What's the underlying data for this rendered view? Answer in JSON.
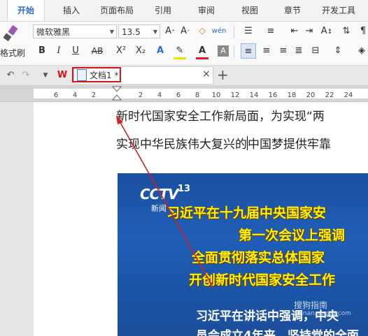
{
  "ribbon_tabs": [
    "开始",
    "插入",
    "页面布局",
    "引用",
    "审阅",
    "视图",
    "章节",
    "开发工具"
  ],
  "ribbon": {
    "format_painter_label": "格式刷",
    "font_name": "微软雅黑",
    "font_size": "13.5",
    "char_format_glyphs": {
      "bold": "B",
      "italic": "I",
      "underline": "U",
      "strike": "AB",
      "superscript": "X²",
      "subscript": "X₂"
    },
    "font_color_label": "A"
  },
  "document_tab": {
    "title": "文档1 *",
    "close": "×",
    "new_tab": "+"
  },
  "ruler_numbers": [
    "6",
    "4",
    "2",
    "",
    "2",
    "4",
    "6",
    "8",
    "10",
    "12",
    "14",
    "16",
    "18",
    "20",
    "22",
    "24"
  ],
  "document": {
    "line1": "新时代国家安全工作新局面，为实现“两",
    "line2_before_cursor": "实现中华民族伟大复兴的",
    "line2_after_cursor": "中国梦提供牢靠"
  },
  "news_image": {
    "channel_logo": "CCTV",
    "channel_number": "13",
    "channel_sub": "新闻",
    "headline_lines": [
      "习近平在十九届中央国家安",
      "第一次会议上强调",
      "全面贯彻落实总体国家",
      "开创新时代国家安全工作"
    ],
    "sub_lines": [
      "习近平在讲话中强调，中央",
      "员会成立4年来，坚持党的全面"
    ],
    "watermark": "搜狗指南",
    "watermark_url": "zhinan.sogou.com"
  },
  "colors": {
    "accent_blue": "#2b6cd4",
    "highlight_red": "#d6141e",
    "arrow_red": "#d61f1f"
  }
}
